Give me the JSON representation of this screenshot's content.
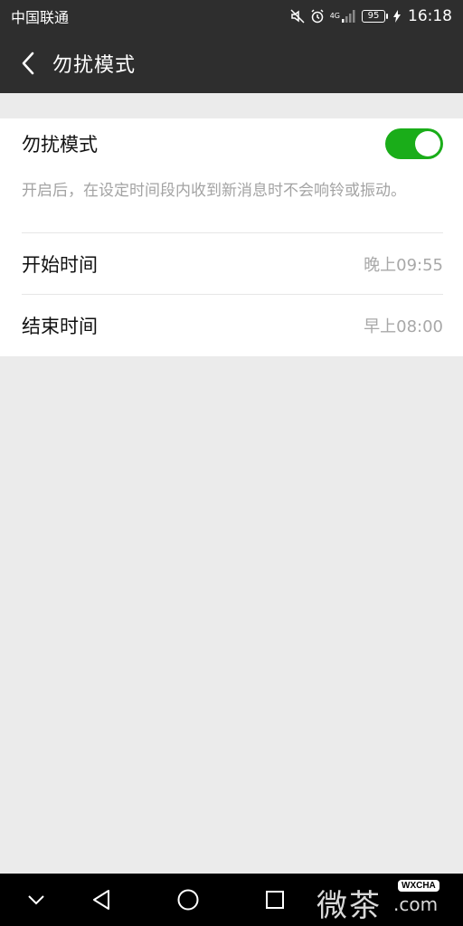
{
  "status_bar": {
    "carrier": "中国联通",
    "network_label": "4G",
    "battery_level": "95",
    "time": "16:18"
  },
  "header": {
    "title": "勿扰模式"
  },
  "settings": {
    "dnd_label": "勿扰模式",
    "dnd_enabled": true,
    "description": "开启后，在设定时间段内收到新消息时不会响铃或振动。",
    "start_time_label": "开始时间",
    "start_time_value": "晚上09:55",
    "end_time_label": "结束时间",
    "end_time_value": "早上08:00"
  },
  "watermark": {
    "chars": "微茶",
    "badge": "WXCHA",
    "domain": ".com"
  },
  "colors": {
    "toggle_on": "#1aad19",
    "header_bg": "#2e2e2e"
  },
  "icons": [
    "mute-icon",
    "alarm-icon",
    "signal-icon",
    "battery-icon",
    "charging-icon",
    "back-arrow-icon",
    "nav-collapse-icon",
    "nav-back-icon",
    "nav-home-icon",
    "nav-recents-icon"
  ]
}
